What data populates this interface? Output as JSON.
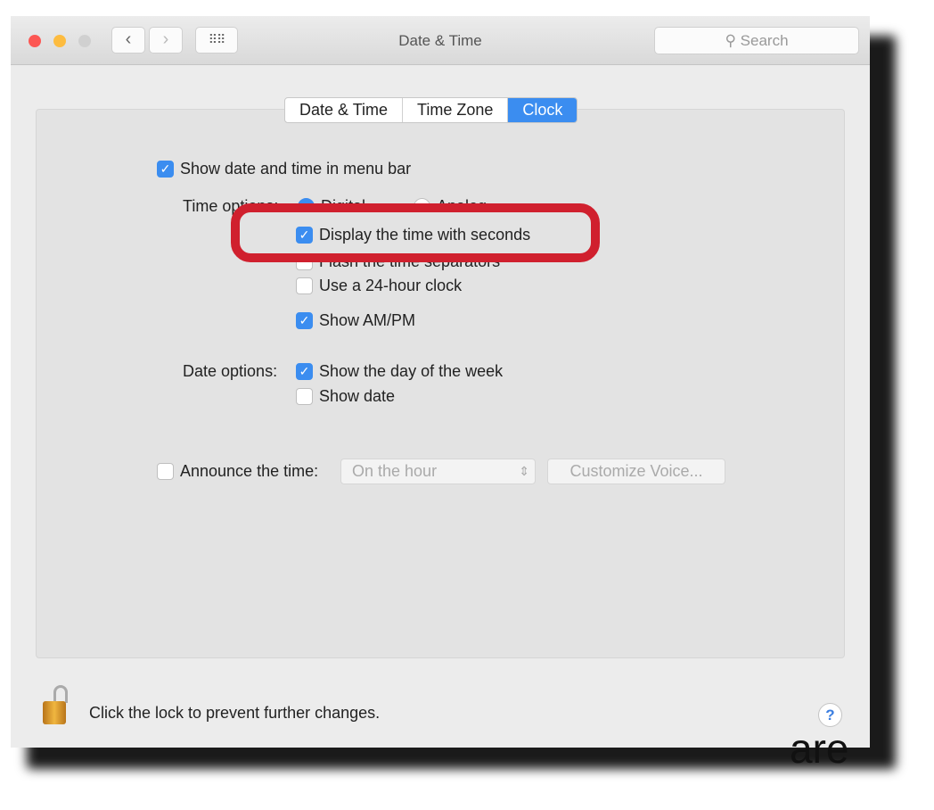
{
  "window": {
    "title": "Date & Time",
    "search_placeholder": "Search"
  },
  "colors": {
    "accent": "#3b8df0",
    "highlight": "#d0202e"
  },
  "tabs": [
    {
      "label": "Date & Time"
    },
    {
      "label": "Time Zone"
    },
    {
      "label": "Clock",
      "active": true
    }
  ],
  "clock": {
    "show_in_menu_bar": {
      "label": "Show date and time in menu bar",
      "checked": true
    },
    "time_options_label": "Time options:",
    "radio_digital": {
      "label": "Digital",
      "selected": true
    },
    "radio_analog": {
      "label": "Analog",
      "selected": false
    },
    "display_seconds": {
      "label": "Display the time with seconds",
      "checked": true
    },
    "flash_separators": {
      "label": "Flash the time separators",
      "checked": false
    },
    "use_24h": {
      "label": "Use a 24-hour clock",
      "checked": false
    },
    "show_ampm": {
      "label": "Show AM/PM",
      "checked": true
    },
    "date_options_label": "Date options:",
    "show_day": {
      "label": "Show the day of the week",
      "checked": true
    },
    "show_date": {
      "label": "Show date",
      "checked": false
    },
    "announce": {
      "label": "Announce the time:",
      "checked": false,
      "interval": "On the hour",
      "customize_label": "Customize Voice..."
    }
  },
  "footer": {
    "lock_text": "Click the lock to prevent further changes.",
    "help": "?"
  },
  "overlay_fragment": "are"
}
